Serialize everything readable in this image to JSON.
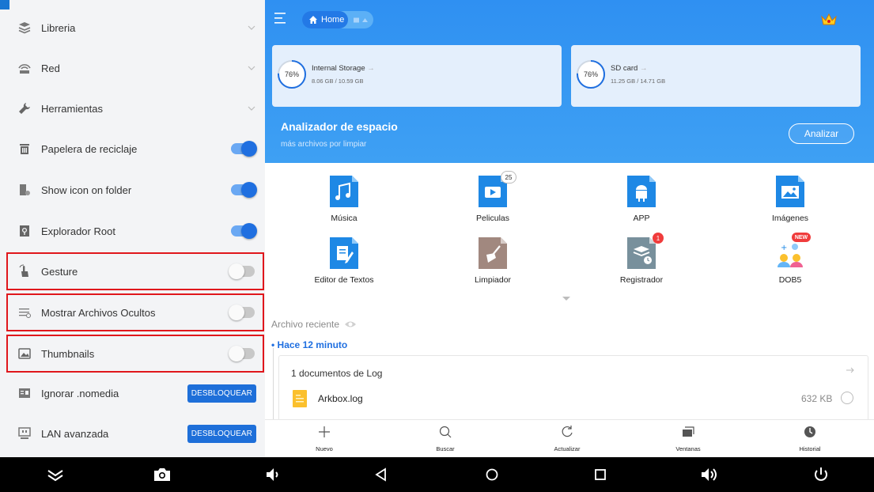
{
  "drawer": {
    "items": [
      {
        "label": "Libreria",
        "icon": "library-icon",
        "control": "chevron"
      },
      {
        "label": "Red",
        "icon": "network-icon",
        "control": "chevron"
      },
      {
        "label": "Herramientas",
        "icon": "wrench-icon",
        "control": "chevron"
      },
      {
        "label": "Papelera de reciclaje",
        "icon": "trash-icon",
        "control": "toggle",
        "on": true
      },
      {
        "label": "Show icon on folder",
        "icon": "folder-icon",
        "control": "toggle",
        "on": true
      },
      {
        "label": "Explorador Root",
        "icon": "root-icon",
        "control": "toggle",
        "on": true
      },
      {
        "label": "Gesture",
        "icon": "gesture-icon",
        "control": "toggle",
        "on": false
      },
      {
        "label": "Mostrar Archivos Ocultos",
        "icon": "hidden-files-icon",
        "control": "toggle",
        "on": false
      },
      {
        "label": "Thumbnails",
        "icon": "thumbnails-icon",
        "control": "toggle",
        "on": false
      },
      {
        "label": "Ignorar .nomedia",
        "icon": "nomedia-icon",
        "control": "button",
        "button_label": "DESBLOQUEAR"
      },
      {
        "label": "LAN avanzada",
        "icon": "lan-icon",
        "control": "button",
        "button_label": "DESBLOQUEAR"
      }
    ]
  },
  "header": {
    "home_label": "Home",
    "storage": [
      {
        "name": "Internal Storage",
        "percent": "76%",
        "size": "8.06 GB / 10.59 GB",
        "fill": 0.76
      },
      {
        "name": "SD card",
        "percent": "76%",
        "size": "11.25 GB / 14.71 GB",
        "fill": 0.76
      }
    ],
    "analyzer_title": "Analizador de espacio",
    "analyzer_subtitle": "más archivos por limpiar",
    "analyze_button": "Analizar"
  },
  "categories": [
    {
      "label": "Música",
      "icon": "music-icon"
    },
    {
      "label": "Peliculas",
      "icon": "video-icon",
      "badge": "25"
    },
    {
      "label": "APP",
      "icon": "android-icon"
    },
    {
      "label": "Imágenes",
      "icon": "image-icon"
    },
    {
      "label": "Editor de Textos",
      "icon": "text-editor-icon"
    },
    {
      "label": "Limpiador",
      "icon": "broom-icon"
    },
    {
      "label": "Registrador",
      "icon": "recorder-icon",
      "badge": "1"
    },
    {
      "label": "DOB5",
      "icon": "game-icon",
      "badge": "NEW"
    }
  ],
  "recent": {
    "section_label": "Archivo reciente",
    "time_label": "Hace 12 minuto",
    "card_title": "1 documentos de Log",
    "file_name": "Arkbox.log",
    "file_size": "632 KB"
  },
  "bottom_bar": [
    {
      "label": "Nuevo",
      "icon": "plus-icon"
    },
    {
      "label": "Buscar",
      "icon": "search-icon"
    },
    {
      "label": "Actualizar",
      "icon": "refresh-icon"
    },
    {
      "label": "Ventanas",
      "icon": "windows-icon"
    },
    {
      "label": "Historial",
      "icon": "history-icon"
    }
  ],
  "navbar": [
    "collapse-icon",
    "camera-icon",
    "volume-down-icon",
    "back-icon",
    "home-icon",
    "recents-icon",
    "volume-up-icon",
    "power-icon"
  ],
  "colors": {
    "accent": "#1f6fe0",
    "header_blue": "#3196f3",
    "highlight_red": "#e0171c",
    "badge_red": "#f03c3c"
  }
}
